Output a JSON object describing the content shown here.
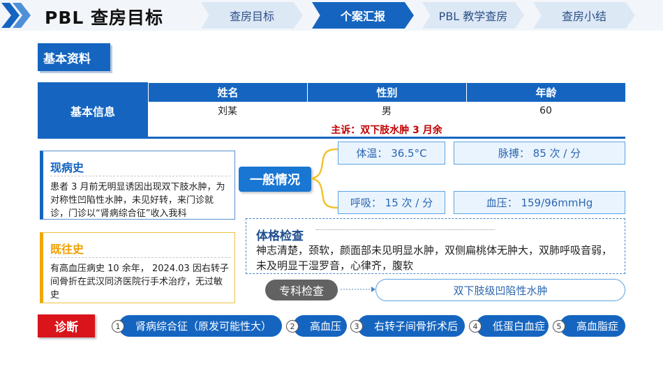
{
  "header": {
    "title": "PBL 查房目标",
    "tabs": [
      {
        "label": "查房目标",
        "active": false
      },
      {
        "label": "个案汇报",
        "active": true
      },
      {
        "label": "PBL 教学查房",
        "active": false
      },
      {
        "label": "查房小结",
        "active": false
      }
    ]
  },
  "section_label": "基本资料",
  "basic_info": {
    "row_label": "基本信息",
    "columns": [
      "姓名",
      "性别",
      "年龄"
    ],
    "values": [
      "刘某",
      "男",
      "60"
    ],
    "chief_complaint": "主诉：双下肢水肿 3 月余"
  },
  "present_history": {
    "title": "现病史",
    "text": "患者 3 月前无明显诱因出现双下肢水肿，为对称性凹陷性水肿，未见好转，来门诊就诊，门诊以“肾病综合征”收入我科"
  },
  "past_history": {
    "title": "既往史",
    "text": "有高血压病史 10 余年， 2024.03 因右转子间骨折在武汉同济医院行手术治疗，无过敏史"
  },
  "general": {
    "label": "一般情况",
    "temperature": "体温： 36.5°C",
    "pulse": "脉搏： 85 次 / 分",
    "respiration": "呼吸： 15 次 / 分",
    "blood_pressure": "血压： 159/96mmHg"
  },
  "physical_exam": {
    "title": "体格检查",
    "text": "神志清楚，颈软，颜面部未见明显水肿，双侧扁桃体无肿大，双肺呼吸音弱，未及明显干湿罗音，心律齐，腹软"
  },
  "special_exam": {
    "label": "专科检查",
    "result": "双下肢级凹陷性水肿"
  },
  "diagnosis": {
    "label": "诊断",
    "items": [
      {
        "num": "1",
        "text": "肾病综合征（原发可能性大）"
      },
      {
        "num": "2",
        "text": "高血压"
      },
      {
        "num": "3",
        "text": "右转子间骨折术后"
      },
      {
        "num": "4",
        "text": "低蛋白血症"
      },
      {
        "num": "5",
        "text": "高血脂症"
      }
    ]
  },
  "colors": {
    "primary_blue": "#1565c0",
    "diagnosis_red": "#d9141a",
    "complaint_red": "#c00000",
    "past_history_accent": "#f0a800",
    "brace_yellow": "#f2c230"
  }
}
